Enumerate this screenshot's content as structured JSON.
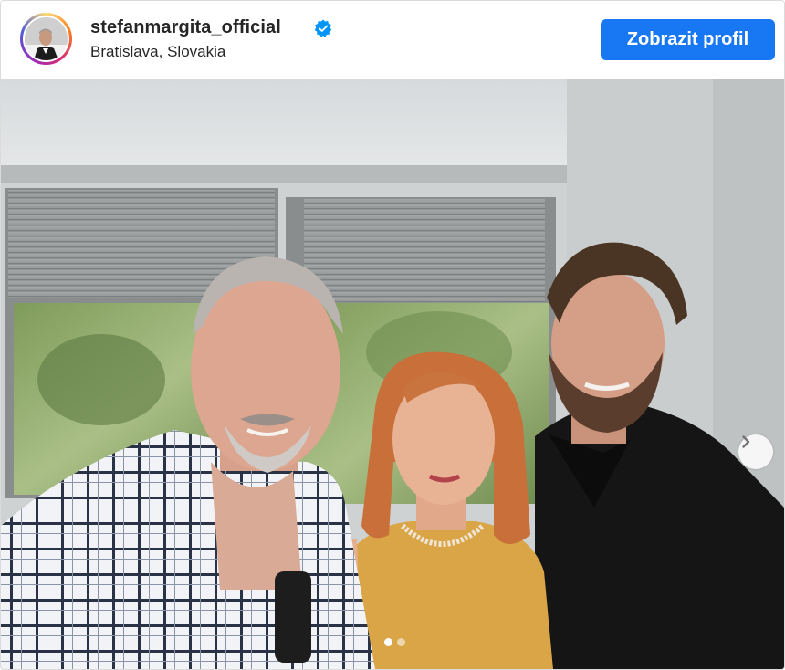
{
  "post": {
    "username": "stefanmargita_official",
    "location": "Bratislava, Slovakia",
    "verified_icon": "verified-badge-icon",
    "profile_button_label": "Zobrazit profil",
    "next_icon": "chevron-right-icon",
    "carousel_total": 2,
    "carousel_active": 1
  },
  "colors": {
    "button": "#1877f2",
    "text": "#262626",
    "verified": "#0095f6"
  }
}
